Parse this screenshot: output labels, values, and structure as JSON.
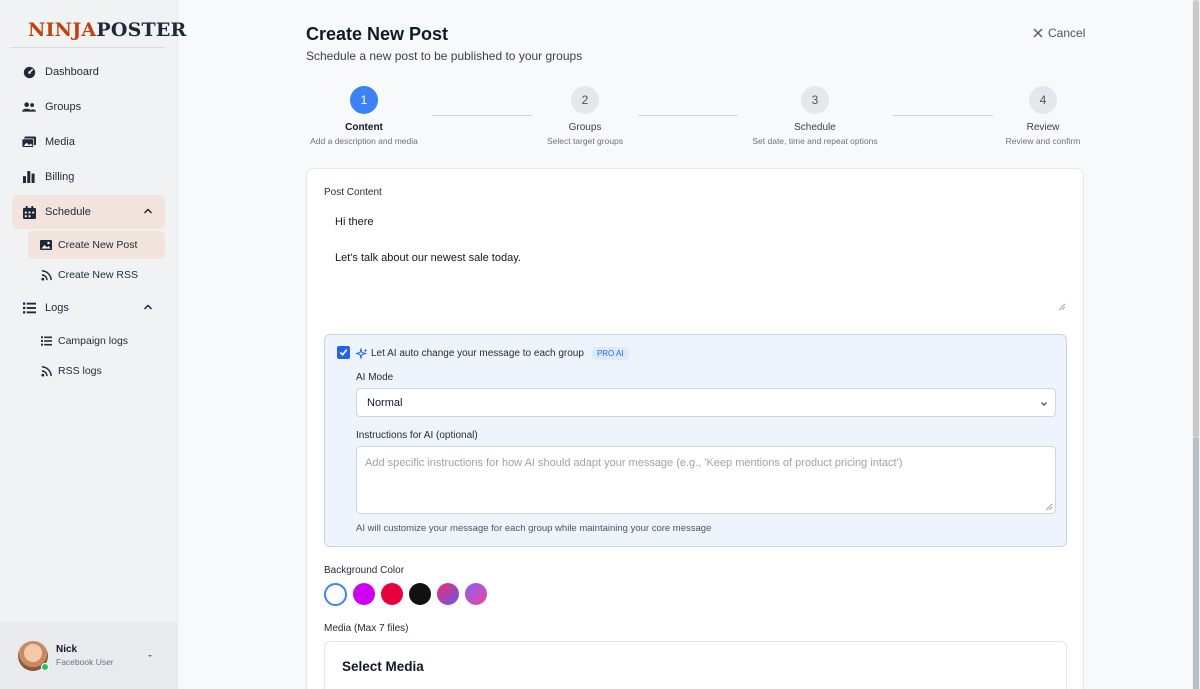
{
  "brand": {
    "logo_text_left": "NINJA",
    "logo_text_right": "POSTER",
    "accent": "#c2410c"
  },
  "sidebar": {
    "items": [
      {
        "label": "Dashboard",
        "icon": "dashboard-icon"
      },
      {
        "label": "Groups",
        "icon": "users-icon"
      },
      {
        "label": "Media",
        "icon": "images-icon"
      },
      {
        "label": "Billing",
        "icon": "bar-chart-icon"
      },
      {
        "label": "Schedule",
        "icon": "calendar-icon",
        "expanded": true,
        "active": true
      },
      {
        "label": "Logs",
        "icon": "list-icon",
        "expanded": true
      }
    ],
    "schedule_sub": [
      {
        "label": "Create New Post",
        "icon": "image-icon",
        "active": true
      },
      {
        "label": "Create New RSS",
        "icon": "rss-icon"
      }
    ],
    "logs_sub": [
      {
        "label": "Campaign logs",
        "icon": "list-icon"
      },
      {
        "label": "RSS logs",
        "icon": "rss-icon"
      }
    ],
    "user": {
      "name": "Nick",
      "role": "Facebook User",
      "status": "online"
    }
  },
  "header": {
    "title": "Create New Post",
    "subtitle": "Schedule a new post to be published to your groups",
    "cancel_label": "Cancel"
  },
  "steps": [
    {
      "number": "1",
      "label": "Content",
      "desc": "Add a description and media",
      "current": true
    },
    {
      "number": "2",
      "label": "Groups",
      "desc": "Select target groups"
    },
    {
      "number": "3",
      "label": "Schedule",
      "desc": "Set date, time and repeat options"
    },
    {
      "number": "4",
      "label": "Review",
      "desc": "Review and confirm"
    }
  ],
  "form": {
    "post_content_label": "Post Content",
    "post_content_value": "Hi there\n\nLet's talk about our newest sale today.",
    "ai": {
      "checked": true,
      "label": "Let AI auto change your message to each group",
      "badge": "PRO AI",
      "mode_label": "AI Mode",
      "mode_value": "Normal",
      "instructions_label": "Instructions for AI (optional)",
      "instructions_placeholder": "Add specific instructions for how AI should adapt your message (e.g., 'Keep mentions of product pricing intact')",
      "help": "AI will customize your message for each group while maintaining your core message"
    },
    "background_color_label": "Background Color",
    "background_colors": [
      "#ffffff",
      "#cc00ee",
      "#e8003c",
      "#111111",
      "gradient-pink-blue",
      "gradient-purple-pink"
    ],
    "media_label": "Media (Max 7 files)",
    "select_media_title": "Select Media"
  }
}
